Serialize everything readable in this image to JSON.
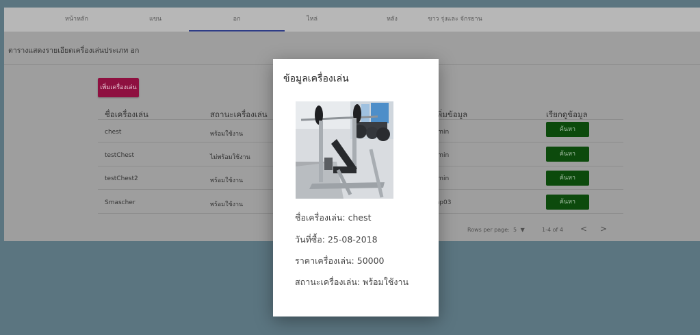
{
  "tabs": [
    {
      "label": "หน้าหลัก"
    },
    {
      "label": "แขน"
    },
    {
      "label": "อก"
    },
    {
      "label": "ไหล่"
    },
    {
      "label": "หลัง"
    },
    {
      "label": "ขาว รุ่งและ จักรยาน"
    }
  ],
  "page": {
    "title": "ตารางแสดงรายเอียดเครื่องเล่นประเภท อก",
    "add_button": "เพิ่มเครื่องเล่น"
  },
  "table": {
    "headers": [
      "ชื่อเครื่องเล่น",
      "สถานะเครื่องเล่น",
      "ผู้เพิ่มข้อมูล",
      "เรียกดูข้อมูล"
    ],
    "rows": [
      {
        "name": "chest",
        "status": "พร้อมใช้งาน",
        "adder": "admin",
        "action": "ค้นหา"
      },
      {
        "name": "testChest",
        "status": "ไม่พร้อมใช้งาน",
        "adder": "admin",
        "action": "ค้นหา"
      },
      {
        "name": "testChest2",
        "status": "พร้อมใช้งาน",
        "adder": "admin",
        "action": "ค้นหา"
      },
      {
        "name": "Smascher",
        "status": "พร้อมใช้งาน",
        "adder": "emp03",
        "action": "ค้นหา"
      }
    ],
    "footer": {
      "rows_per_page_label": "Rows per page:",
      "rows_per_page_value": "5",
      "range": "1-4 of 4",
      "prev": "<",
      "next": ">"
    }
  },
  "dialog": {
    "title": "ข้อมูลเครื่องเล่น",
    "name": "ชื่อเครื่องเล่น: chest",
    "buy_date": "วันที่ซื้อ: 25-08-2018",
    "price": "ราคาเครื่องเล่น: 50000",
    "status": "สถานะเครื่องเล่น: พร้อมใช้งาน"
  },
  "colors": {
    "add_button": "#8e1040",
    "find_button": "#0c4a0c",
    "active_tab": "#2f3d86"
  }
}
